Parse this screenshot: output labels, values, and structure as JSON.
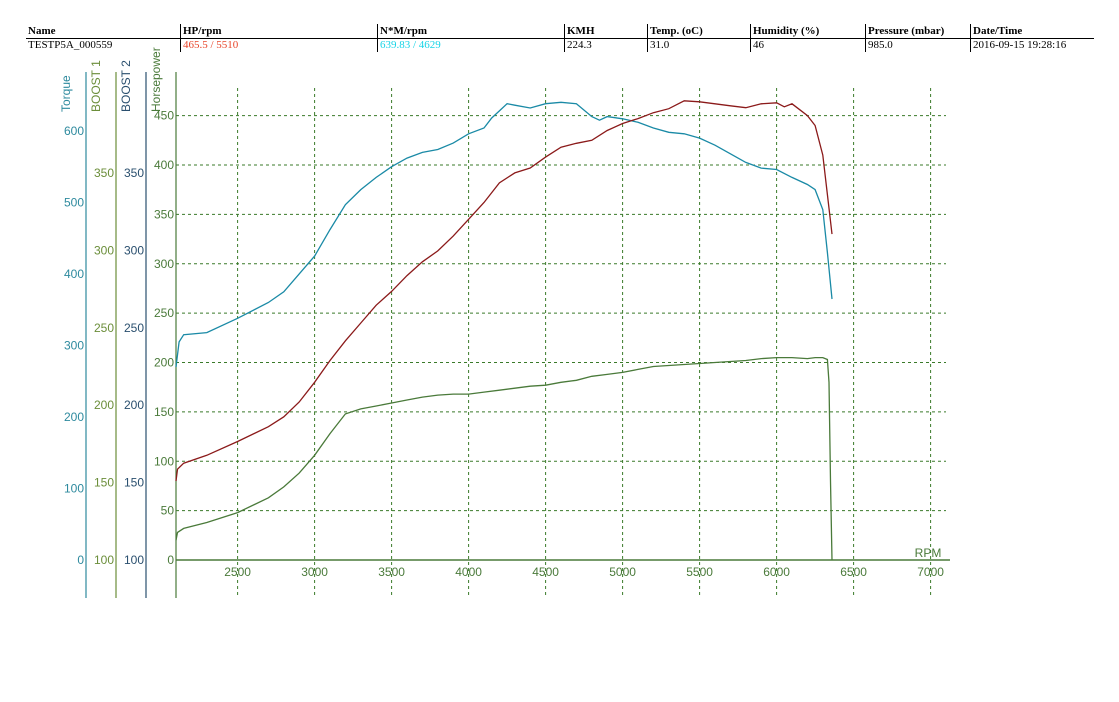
{
  "header": {
    "columns": [
      "Name",
      "HP/rpm",
      "N*M/rpm",
      "KMH",
      "Temp. (oC)",
      "Humidity (%)",
      "Pressure (mbar)",
      "Date/Time"
    ],
    "values": [
      "TESTP5A_000559",
      "465.5 / 5510",
      "639.83 / 4629",
      "224.3",
      "31.0",
      " 46",
      "985.0",
      "2016-09-15 19:28:16"
    ],
    "colors": [
      "#000000",
      "#e8452a",
      "#17d4e6",
      "#000000",
      "#000000",
      "#000000",
      "#000000",
      "#000000"
    ]
  },
  "chart_data": {
    "type": "line",
    "x_label": "RPM",
    "x_ticks": [
      2500,
      3000,
      3500,
      4000,
      4500,
      5000,
      5500,
      6000,
      6500,
      7000
    ],
    "x_range": [
      2100,
      7100
    ],
    "grid": true,
    "axes": [
      {
        "label": "Torque",
        "color": "#2e8a9e",
        "ticks": [
          0,
          100,
          200,
          300,
          400,
          500,
          600
        ],
        "range": [
          0,
          660
        ]
      },
      {
        "label": "BOOST 1",
        "color": "#6b8e3a",
        "ticks": [
          100,
          150,
          200,
          250,
          300,
          350
        ],
        "range": [
          100,
          405
        ]
      },
      {
        "label": "BOOST 2",
        "color": "#2a4f6e",
        "ticks": [
          100,
          150,
          200,
          250,
          300,
          350
        ],
        "range": [
          100,
          405
        ]
      },
      {
        "label": "Horsepower",
        "color": "#4a7a3a",
        "ticks": [
          0,
          50,
          100,
          150,
          200,
          250,
          300,
          350,
          400,
          450
        ],
        "range": [
          0,
          478
        ]
      }
    ],
    "series": [
      {
        "axis": "Torque",
        "color": "#1a8aa6",
        "x": [
          2100,
          2120,
          2150,
          2300,
          2500,
          2700,
          2800,
          2900,
          3000,
          3100,
          3200,
          3300,
          3400,
          3500,
          3600,
          3700,
          3800,
          3900,
          4000,
          4100,
          4150,
          4200,
          4250,
          4300,
          4400,
          4500,
          4600,
          4700,
          4800,
          4850,
          4900,
          5000,
          5100,
          5200,
          5300,
          5400,
          5500,
          5600,
          5700,
          5800,
          5900,
          6000,
          6100,
          6200,
          6250,
          6300,
          6330,
          6360
        ],
        "y": [
          270,
          305,
          315,
          318,
          338,
          360,
          375,
          400,
          425,
          462,
          497,
          518,
          535,
          550,
          562,
          570,
          574,
          583,
          596,
          604,
          618,
          628,
          638,
          636,
          632,
          638,
          640,
          638,
          620,
          615,
          620,
          617,
          612,
          604,
          598,
          596,
          590,
          580,
          568,
          556,
          548,
          546,
          535,
          525,
          518,
          490,
          430,
          365
        ]
      },
      {
        "axis": "Horsepower",
        "color": "#8b1a1a",
        "x": [
          2100,
          2110,
          2150,
          2300,
          2500,
          2700,
          2800,
          2900,
          3000,
          3100,
          3200,
          3300,
          3400,
          3500,
          3600,
          3700,
          3800,
          3900,
          4000,
          4100,
          4200,
          4300,
          4400,
          4500,
          4600,
          4700,
          4800,
          4900,
          5000,
          5100,
          5200,
          5300,
          5400,
          5500,
          5600,
          5700,
          5800,
          5900,
          6000,
          6050,
          6100,
          6150,
          6200,
          6250,
          6300,
          6330,
          6360
        ],
        "y": [
          80,
          92,
          98,
          106,
          120,
          135,
          145,
          160,
          180,
          202,
          222,
          240,
          258,
          272,
          288,
          302,
          313,
          328,
          345,
          362,
          382,
          392,
          397,
          408,
          418,
          422,
          425,
          435,
          442,
          447,
          453,
          457,
          465,
          464,
          462,
          460,
          458,
          462,
          463,
          459,
          462,
          456,
          450,
          440,
          410,
          370,
          330
        ]
      },
      {
        "axis": "Horsepower",
        "color": "#4a7a3a",
        "x": [
          2100,
          2110,
          2150,
          2300,
          2500,
          2700,
          2800,
          2900,
          3000,
          3100,
          3200,
          3300,
          3400,
          3500,
          3600,
          3700,
          3800,
          3900,
          4000,
          4100,
          4200,
          4300,
          4400,
          4500,
          4600,
          4700,
          4800,
          4900,
          5000,
          5100,
          5200,
          5300,
          5400,
          5500,
          5600,
          5700,
          5800,
          5900,
          6000,
          6100,
          6200,
          6250,
          6300,
          6330,
          6340,
          6350,
          6360
        ],
        "y": [
          20,
          28,
          32,
          38,
          48,
          63,
          74,
          88,
          106,
          128,
          148,
          153,
          156,
          159,
          162,
          165,
          167,
          168,
          168,
          170,
          172,
          174,
          176,
          177,
          180,
          182,
          186,
          188,
          190,
          193,
          196,
          197,
          198,
          199,
          200,
          201,
          202,
          204,
          205,
          205,
          204,
          205,
          205,
          203,
          180,
          80,
          0
        ]
      }
    ]
  }
}
